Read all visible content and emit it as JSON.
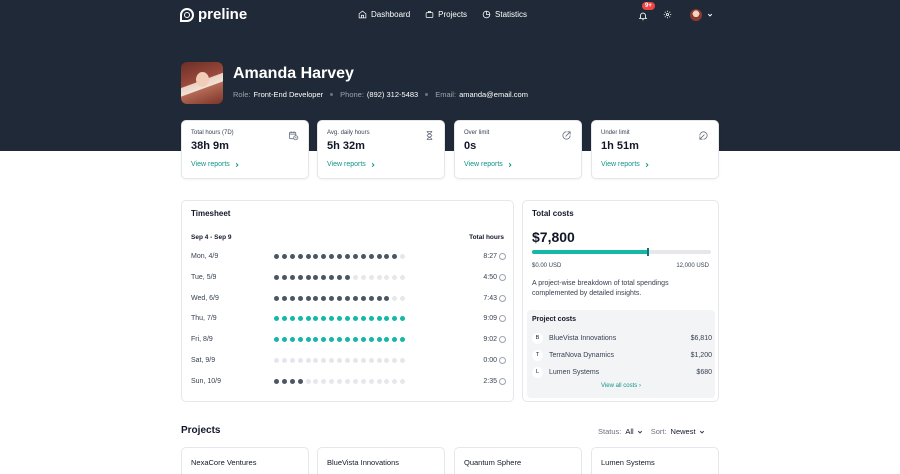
{
  "brand": {
    "name": "preline"
  },
  "nav": {
    "links": [
      {
        "label": "Dashboard",
        "icon": "home-icon"
      },
      {
        "label": "Projects",
        "icon": "briefcase-icon"
      },
      {
        "label": "Statistics",
        "icon": "pie-chart-icon"
      }
    ],
    "notifications_badge": "9+"
  },
  "profile": {
    "name": "Amanda Harvey",
    "role_label": "Role:",
    "role": "Front-End Developer",
    "phone_label": "Phone:",
    "phone": "(892) 312-5483",
    "email_label": "Email:",
    "email": "amanda@email.com"
  },
  "stats": [
    {
      "label": "Total hours (7D)",
      "value": "38h 9m",
      "link": "View reports",
      "icon": "calendar-clock-icon"
    },
    {
      "label": "Avg. daily hours",
      "value": "5h 32m",
      "link": "View reports",
      "icon": "hourglass-icon"
    },
    {
      "label": "Over limit",
      "value": "0s",
      "link": "View reports",
      "icon": "arrow-up-right-circle-icon"
    },
    {
      "label": "Under limit",
      "value": "1h 51m",
      "link": "View reports",
      "icon": "arrow-down-left-circle-icon"
    }
  ],
  "timesheet": {
    "title": "Timesheet",
    "range": "Sep 4 - Sep 9",
    "total_label": "Total hours",
    "rows": [
      {
        "day": "Mon, 4/9",
        "hours": "8:27",
        "filled": 16,
        "color": "dark"
      },
      {
        "day": "Tue, 5/9",
        "hours": "4:50",
        "filled": 10,
        "color": "dark"
      },
      {
        "day": "Wed, 6/9",
        "hours": "7:43",
        "filled": 15,
        "color": "dark"
      },
      {
        "day": "Thu, 7/9",
        "hours": "9:09",
        "filled": 17,
        "color": "teal"
      },
      {
        "day": "Fri, 8/9",
        "hours": "9:02",
        "filled": 17,
        "color": "teal"
      },
      {
        "day": "Sat, 9/9",
        "hours": "0:00",
        "filled": 0,
        "color": "dark"
      },
      {
        "day": "Sun, 10/9",
        "hours": "2:35",
        "filled": 4,
        "color": "dark"
      }
    ],
    "dot_total": 17
  },
  "costs": {
    "title": "Total costs",
    "amount": "$7,800",
    "progress": 0.65,
    "min_label": "$0.00 USD",
    "max_label": "12,000 USD",
    "description": "A project-wise breakdown of total spendings complemented by detailed insights.",
    "projects_title": "Project costs",
    "projects": [
      {
        "letter": "B",
        "name": "BlueVista Innovations",
        "value": "$6,810"
      },
      {
        "letter": "T",
        "name": "TerraNova Dynamics",
        "value": "$1,200"
      },
      {
        "letter": "L",
        "name": "Lumen Systems",
        "value": "$680"
      }
    ],
    "view_all": "View all costs"
  },
  "projects": {
    "title": "Projects",
    "status_label": "Status:",
    "status_value": "All",
    "sort_label": "Sort:",
    "sort_value": "Newest",
    "cards": [
      "NexaCore Ventures",
      "BlueVista Innovations",
      "Quantum Sphere",
      "Lumen Systems"
    ]
  },
  "colors": {
    "hero": "#1f2937",
    "accent": "#14b8a6",
    "link": "#0f9488",
    "dot_dark": "#4b5563",
    "dot_empty": "#e5e7eb"
  }
}
